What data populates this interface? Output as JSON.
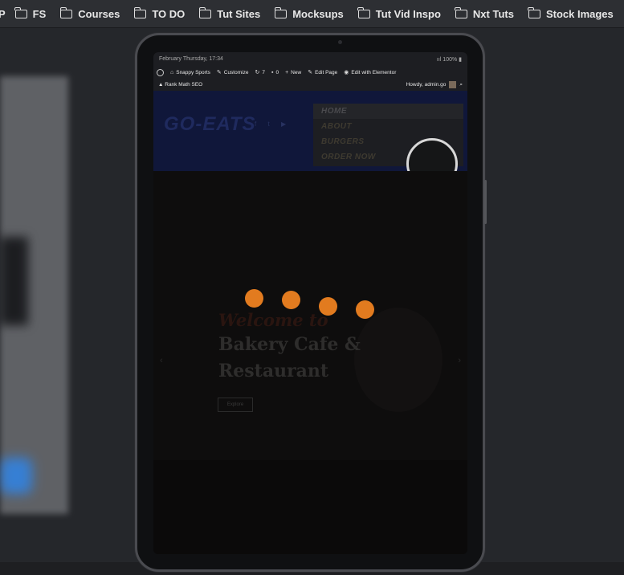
{
  "bookmarks": [
    {
      "label": "P",
      "folder": false
    },
    {
      "label": "FS",
      "folder": true
    },
    {
      "label": "Courses",
      "folder": true
    },
    {
      "label": "TO DO",
      "folder": true
    },
    {
      "label": "Tut Sites",
      "folder": true
    },
    {
      "label": "Mocksups",
      "folder": true
    },
    {
      "label": "Tut Vid Inspo",
      "folder": true
    },
    {
      "label": "Nxt Tuts",
      "folder": true
    },
    {
      "label": "Stock Images",
      "folder": true
    }
  ],
  "status": {
    "datetime": "February Thursday, 17:34",
    "battery": "100%"
  },
  "adminbar": {
    "site": "Snappy Sports",
    "customize": "Customize",
    "updates": "7",
    "comments": "0",
    "new": "New",
    "edit_page": "Edit Page",
    "edit_elementor": "Edit with Elementor"
  },
  "rankbar": {
    "seo": "Rank Math SEO",
    "howdy": "Howdy, admin.go"
  },
  "site": {
    "logo": "GO-EATS",
    "menu": [
      "HOME",
      "ABOUT",
      "BURGERS",
      "ORDER NOW"
    ],
    "hero_welcome": "Welcome to",
    "hero_line1": "Bakery Cafe &",
    "hero_line2": "Restaurant",
    "hero_button": "Explore"
  },
  "colors": {
    "loader": "#e27b1f",
    "header": "#10173a"
  },
  "icons": {
    "folder": "folder-icon",
    "wordpress": "wordpress-icon",
    "search": "search-icon"
  }
}
